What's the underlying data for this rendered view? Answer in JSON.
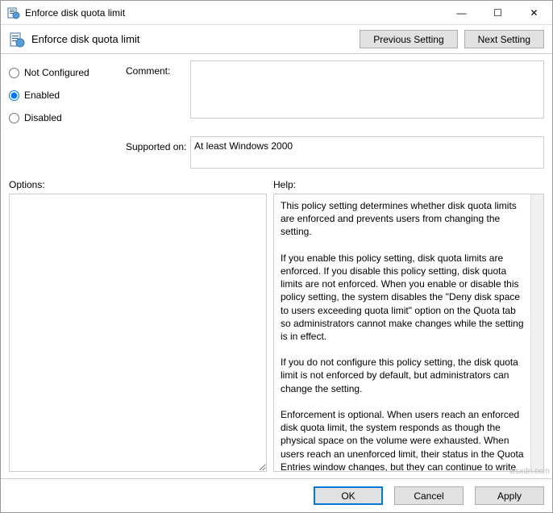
{
  "window": {
    "title": "Enforce disk quota limit",
    "minimize": "—",
    "maximize": "☐",
    "close": "✕"
  },
  "header": {
    "policy_name": "Enforce disk quota limit",
    "prev_btn": "Previous Setting",
    "next_btn": "Next Setting"
  },
  "state": {
    "not_configured": "Not Configured",
    "enabled": "Enabled",
    "disabled": "Disabled",
    "selected": "enabled"
  },
  "comment": {
    "label": "Comment:",
    "value": ""
  },
  "supported": {
    "label": "Supported on:",
    "value": "At least Windows 2000"
  },
  "sections": {
    "options_label": "Options:",
    "help_label": "Help:"
  },
  "options": {
    "value": ""
  },
  "help": {
    "text": "This policy setting determines whether disk quota limits are enforced and prevents users from changing the setting.\n\nIf you enable this policy setting, disk quota limits are enforced. If you disable this policy setting, disk quota limits are not enforced. When you enable or disable this policy setting, the system disables the \"Deny disk space to users exceeding quota limit\" option on the Quota tab so administrators cannot make changes while the setting is in effect.\n\nIf you do not configure this policy setting, the disk quota limit is not enforced by default, but administrators can change the setting.\n\nEnforcement is optional. When users reach an enforced disk quota limit, the system responds as though the physical space on the volume were exhausted. When users reach an unenforced limit, their status in the Quota Entries window changes, but they can continue to write to the volume as long as physical space is available."
  },
  "footer": {
    "ok": "OK",
    "cancel": "Cancel",
    "apply": "Apply"
  },
  "watermark": "wsxdn.com"
}
